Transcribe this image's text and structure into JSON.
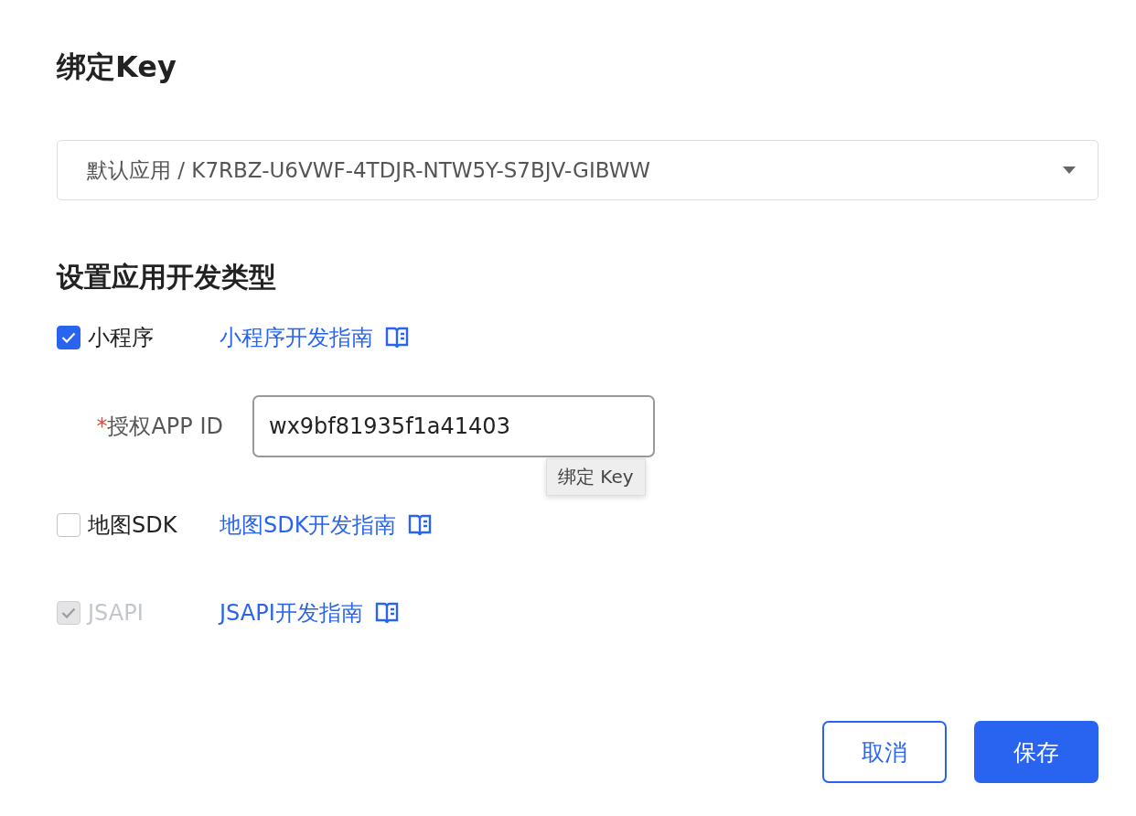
{
  "title": "绑定Key",
  "key_select": {
    "value": "默认应用 / K7RBZ-U6VWF-4TDJR-NTW5Y-S7BJV-GIBWW"
  },
  "section_title": "设置应用开发类型",
  "options": [
    {
      "label": "小程序",
      "checked": true,
      "disabled": false,
      "guide": "小程序开发指南",
      "field": {
        "label": "授权APP ID",
        "required_mark": "*",
        "value": "wx9bf81935f1a41403",
        "tooltip": "绑定 Key"
      }
    },
    {
      "label": "地图SDK",
      "checked": false,
      "disabled": false,
      "guide": "地图SDK开发指南"
    },
    {
      "label": "JSAPI",
      "checked": true,
      "disabled": true,
      "guide": "JSAPI开发指南"
    }
  ],
  "buttons": [
    {
      "label": "取消",
      "kind": "secondary"
    },
    {
      "label": "保存",
      "kind": "primary"
    }
  ]
}
